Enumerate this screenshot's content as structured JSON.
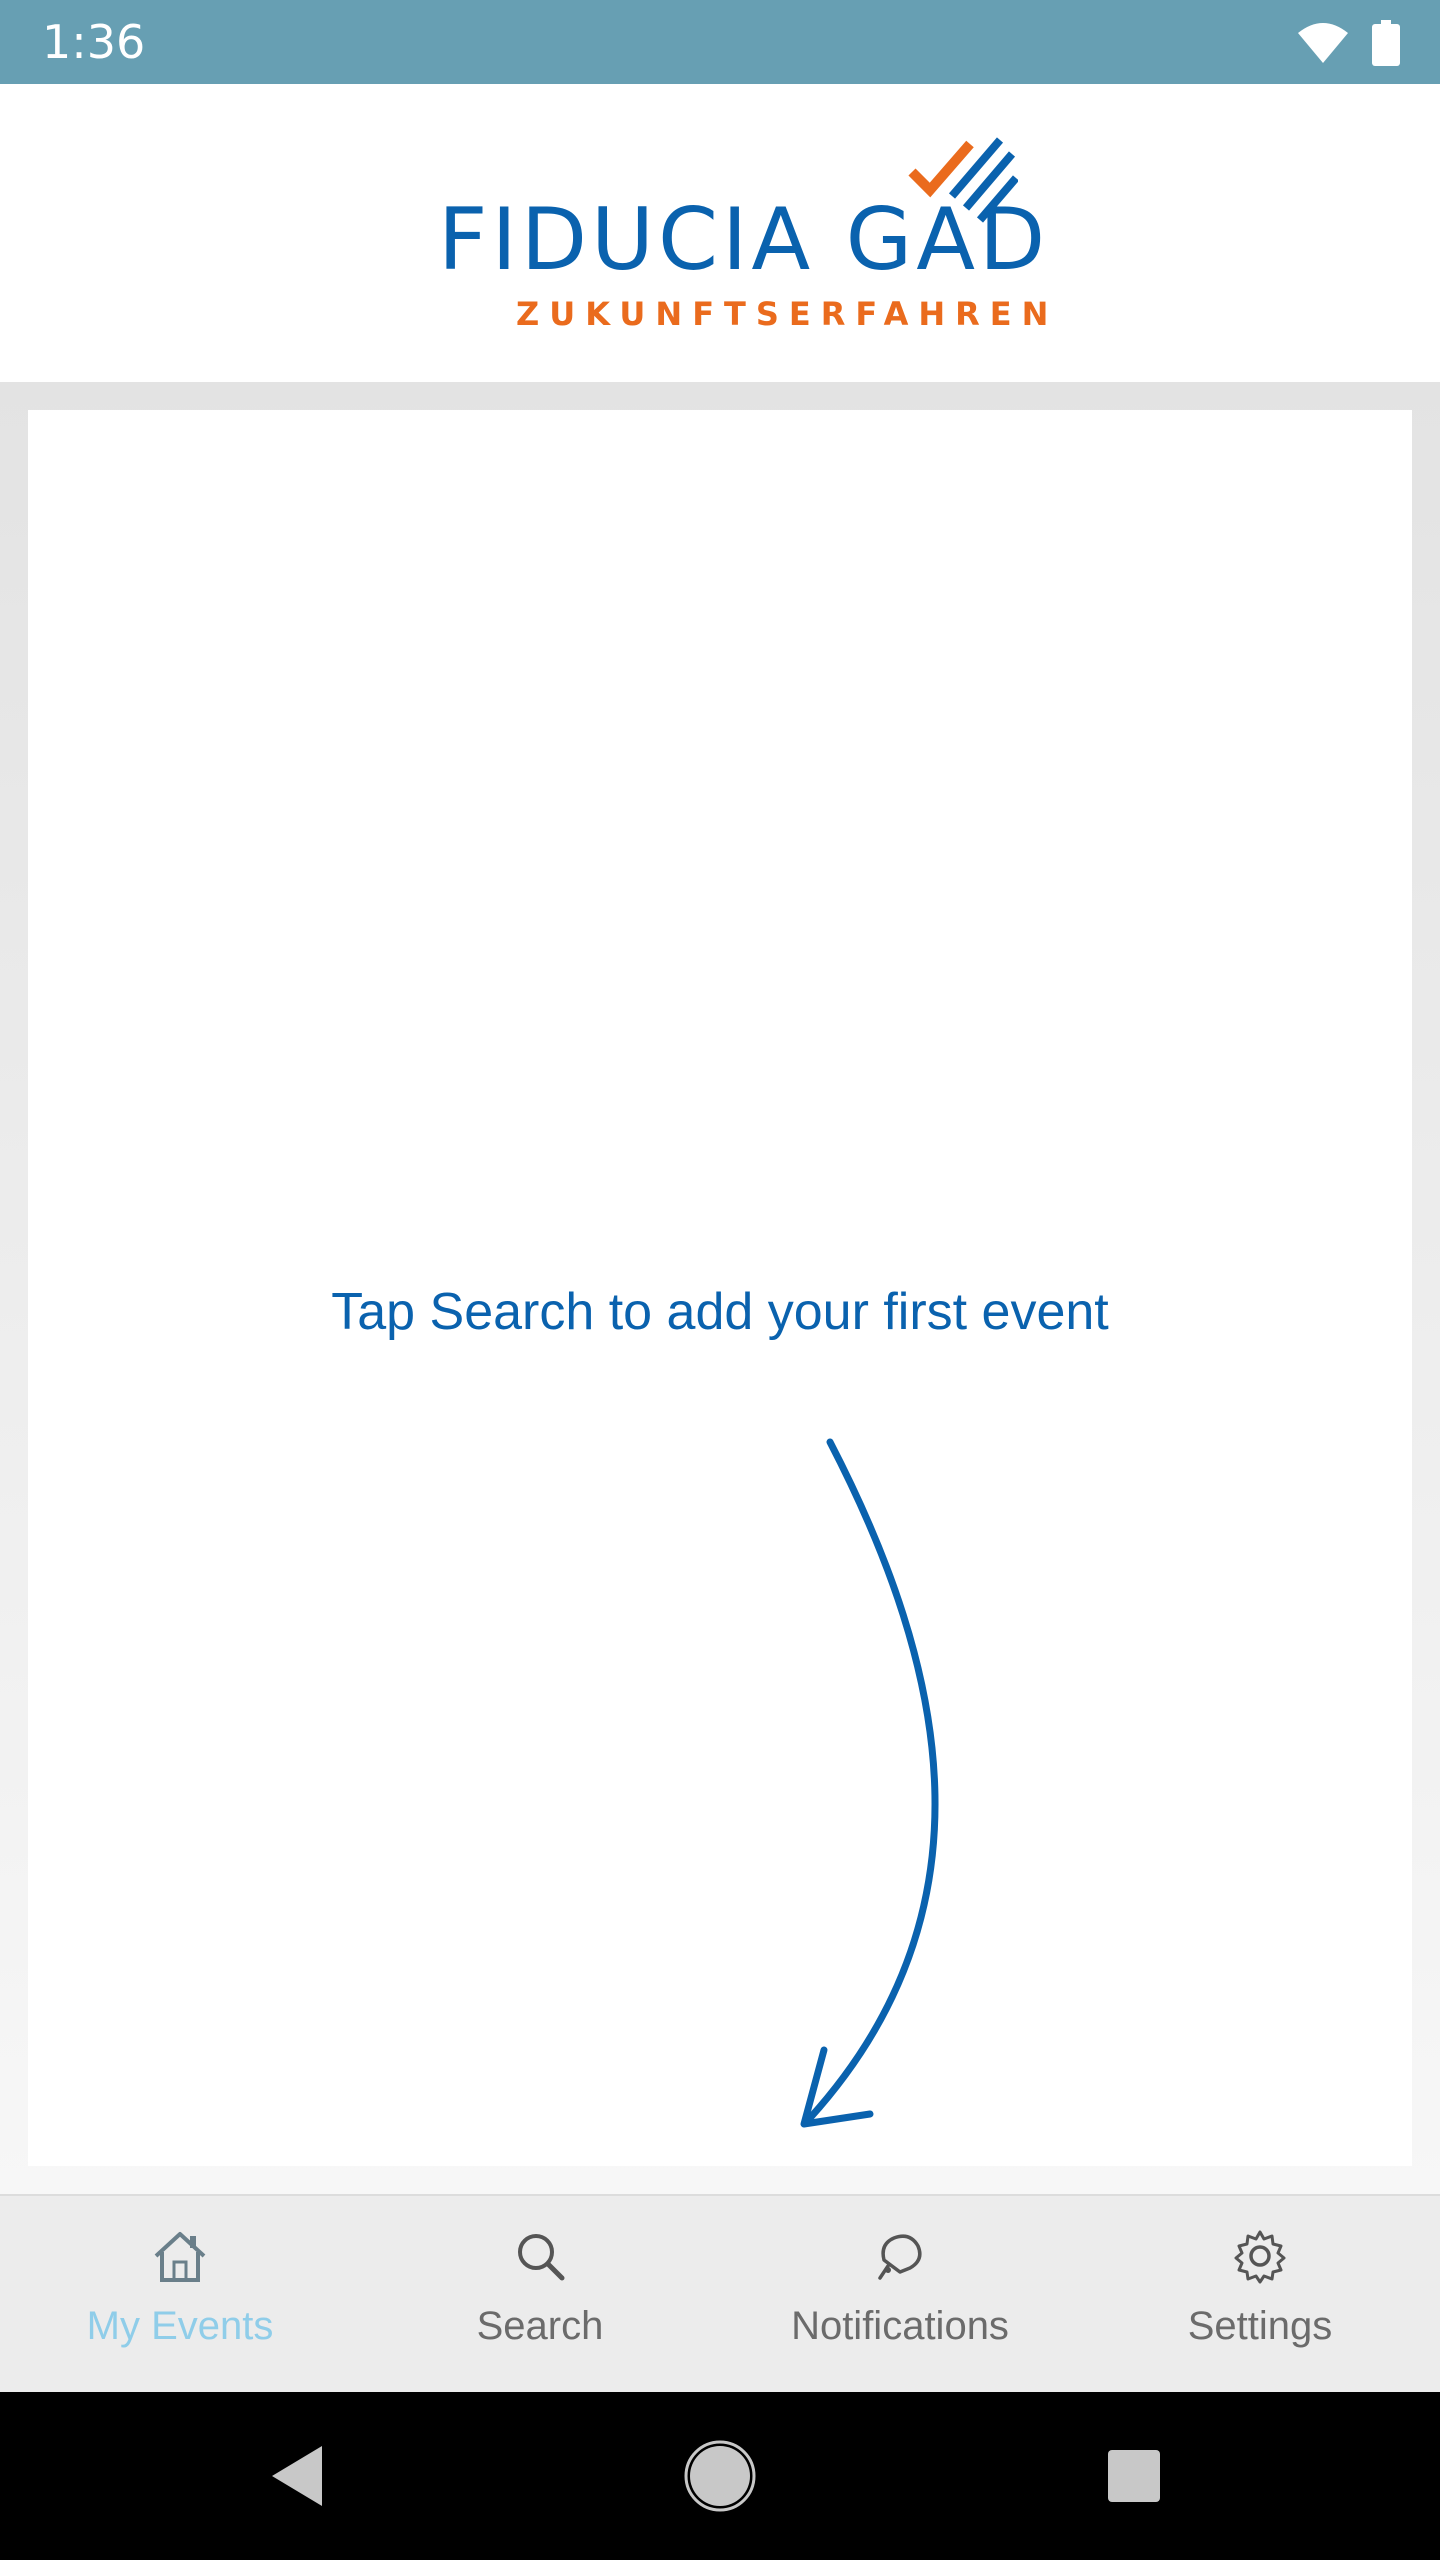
{
  "status_bar": {
    "time": "1:36",
    "icons": [
      "wifi-icon",
      "battery-icon"
    ]
  },
  "header": {
    "logo_title": "FIDUCIA GAD",
    "logo_subtitle": "ZUKUNFTSERFAHREN",
    "brand_blue": "#0a62ae",
    "brand_orange": "#ea6b1d"
  },
  "main": {
    "empty_hint": "Tap Search to add your first event"
  },
  "tabs": [
    {
      "label": "My Events",
      "icon": "home-icon",
      "active": true
    },
    {
      "label": "Search",
      "icon": "search-icon",
      "active": false
    },
    {
      "label": "Notifications",
      "icon": "bell-icon",
      "active": false
    },
    {
      "label": "Settings",
      "icon": "gear-icon",
      "active": false
    }
  ],
  "colors": {
    "status_bar": "#679fb3",
    "active_tab": "#8fcde9",
    "inactive_tab": "#6b6b6b"
  },
  "nav_bar": {
    "buttons": [
      "back-icon",
      "home-circle-icon",
      "recents-icon"
    ]
  }
}
